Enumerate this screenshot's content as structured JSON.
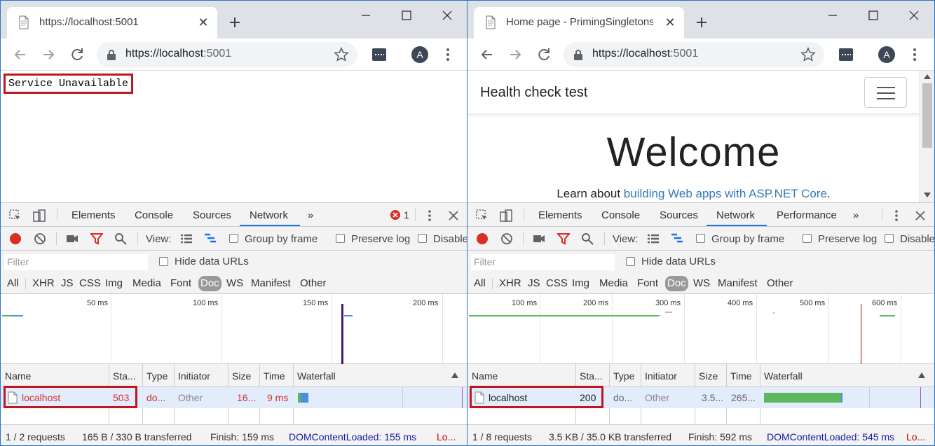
{
  "left": {
    "tab_title": "https://localhost:5001",
    "url_host": "https://localhost",
    "url_port": ":5001",
    "avatar": "A",
    "page_text": "Service Unavailable",
    "devtools": {
      "tabs": [
        "Elements",
        "Console",
        "Sources",
        "Network"
      ],
      "more": "»",
      "error_count": "1",
      "view_label": "View:",
      "group_by_frame": "Group by frame",
      "preserve_log": "Preserve log",
      "disable_cache": "Disable",
      "filter_placeholder": "Filter",
      "hide_data_urls": "Hide data URLs",
      "types": [
        "All",
        "XHR",
        "JS",
        "CSS",
        "Img",
        "Media",
        "Font",
        "Doc",
        "WS",
        "Manifest",
        "Other"
      ],
      "selected_type": "Doc",
      "overview_ticks": [
        "50 ms",
        "100 ms",
        "150 ms",
        "200 ms"
      ],
      "columns": [
        "Name",
        "Sta...",
        "Type",
        "Initiator",
        "Size",
        "Time",
        "Waterfall"
      ],
      "row": {
        "name": "localhost",
        "status": "503",
        "type": "do...",
        "initiator": "Other",
        "size": "16...",
        "time": "9 ms"
      },
      "status_bar": {
        "requests": "1 / 2 requests",
        "transferred": "165 B / 330 B transferred",
        "finish": "Finish: 159 ms",
        "dcl": "DOMContentLoaded: 155 ms",
        "load": "Lo..."
      }
    }
  },
  "right": {
    "tab_title": "Home page - PrimingSingletons",
    "url_host": "https://localhost",
    "url_port": ":5001",
    "avatar": "A",
    "brand": "Health check test",
    "welcome": "Welcome",
    "learn_prefix": "Learn about ",
    "learn_link": "building Web apps with ASP.NET Core",
    "learn_suffix": ".",
    "devtools": {
      "tabs": [
        "Elements",
        "Console",
        "Sources",
        "Network",
        "Performance"
      ],
      "more": "»",
      "view_label": "View:",
      "group_by_frame": "Group by frame",
      "preserve_log": "Preserve log",
      "disable_cache": "Disable",
      "filter_placeholder": "Filter",
      "hide_data_urls": "Hide data URLs",
      "types": [
        "All",
        "XHR",
        "JS",
        "CSS",
        "Img",
        "Media",
        "Font",
        "Doc",
        "WS",
        "Manifest",
        "Other"
      ],
      "selected_type": "Doc",
      "overview_ticks": [
        "100 ms",
        "200 ms",
        "300 ms",
        "400 ms",
        "500 ms",
        "600 ms"
      ],
      "columns": [
        "Name",
        "Sta...",
        "Type",
        "Initiator",
        "Size",
        "Time",
        "Waterfall"
      ],
      "row": {
        "name": "localhost",
        "status": "200",
        "type": "do...",
        "initiator": "Other",
        "size": "3.5...",
        "time": "265..."
      },
      "status_bar": {
        "requests": "1 / 8 requests",
        "transferred": "3.5 KB / 35.0 KB transferred",
        "finish": "Finish: 592 ms",
        "dcl": "DOMContentLoaded: 545 ms",
        "load": "Lo..."
      }
    }
  },
  "colors": {
    "highlight_red": "#c0161e",
    "active_tab_blue": "#1a73e8",
    "link_blue": "#337ab7",
    "dcl_blue": "#1a1aa6",
    "load_red": "#c80000",
    "error_row_red": "#d32f2f",
    "waterfall_green": "#5cb85c",
    "waterfall_blue": "#4a8fe0"
  }
}
